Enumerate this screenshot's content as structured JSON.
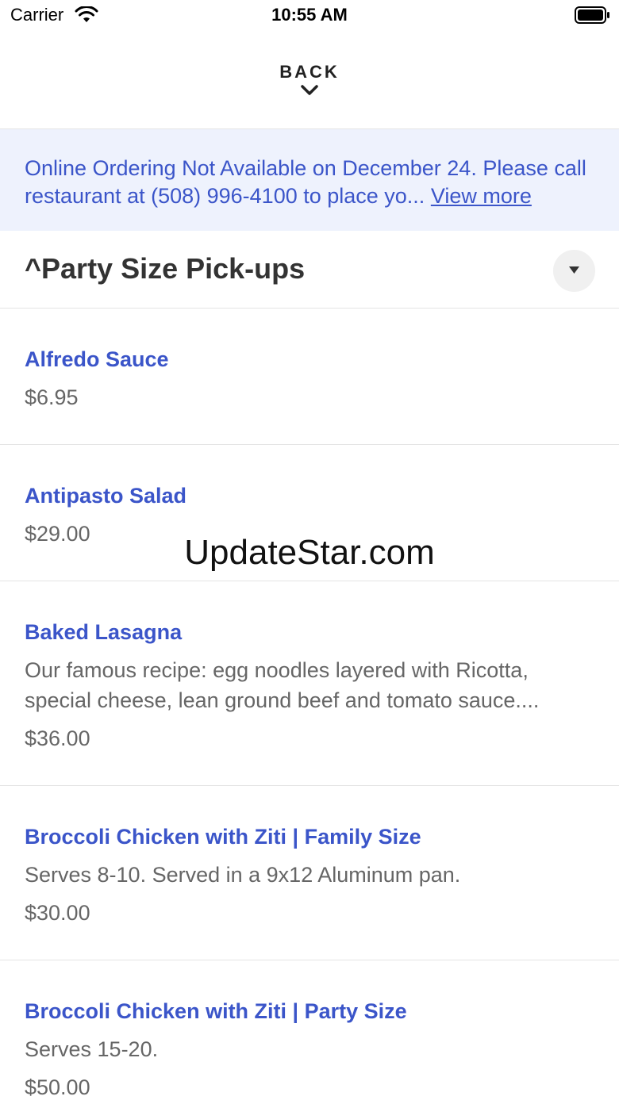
{
  "status_bar": {
    "carrier": "Carrier",
    "time": "10:55 AM"
  },
  "nav": {
    "back_label": "BACK"
  },
  "banner": {
    "text": "Online Ordering Not Available on December 24. Please call restaurant at (508) 996-4100 to place yo... ",
    "link_label": "View more"
  },
  "category": {
    "title": "^Party Size Pick-ups"
  },
  "items": [
    {
      "name": "Alfredo Sauce",
      "description": "",
      "price": "$6.95"
    },
    {
      "name": "Antipasto Salad",
      "description": "",
      "price": "$29.00"
    },
    {
      "name": "Baked Lasagna",
      "description": "Our famous recipe: egg noodles layered with Ricotta,\nspecial cheese, lean ground beef and tomato sauce....",
      "price": "$36.00"
    },
    {
      "name": "Broccoli Chicken with Ziti | Family Size",
      "description": "Serves 8-10. Served in a 9x12 Aluminum pan.",
      "price": "$30.00"
    },
    {
      "name": "Broccoli Chicken with Ziti | Party Size",
      "description": "Serves 15-20.",
      "price": "$50.00"
    }
  ],
  "watermark": "UpdateStar.com",
  "colors": {
    "accent": "#3b55c9",
    "banner_bg": "#eef2fd",
    "muted_text": "#666666"
  }
}
